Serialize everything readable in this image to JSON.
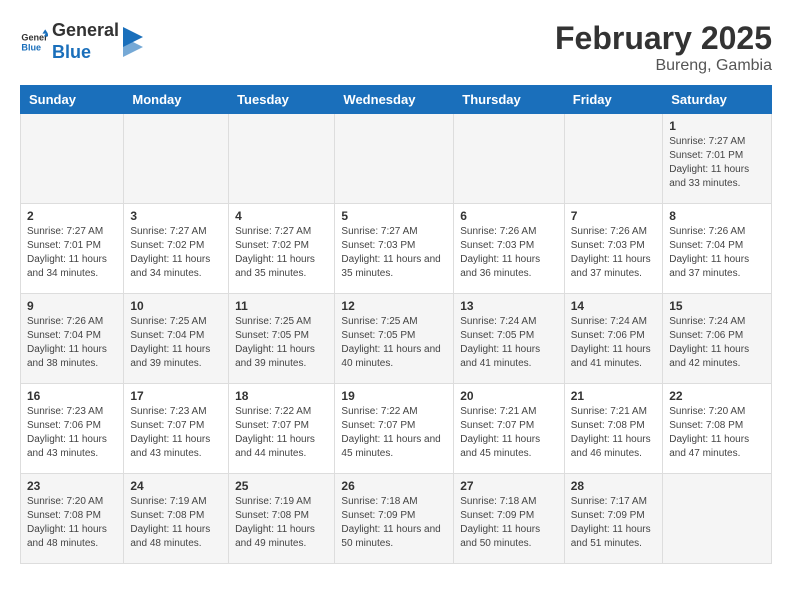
{
  "logo": {
    "text_general": "General",
    "text_blue": "Blue"
  },
  "title": "February 2025",
  "subtitle": "Bureng, Gambia",
  "days_of_week": [
    "Sunday",
    "Monday",
    "Tuesday",
    "Wednesday",
    "Thursday",
    "Friday",
    "Saturday"
  ],
  "weeks": [
    [
      {
        "day": "",
        "info": ""
      },
      {
        "day": "",
        "info": ""
      },
      {
        "day": "",
        "info": ""
      },
      {
        "day": "",
        "info": ""
      },
      {
        "day": "",
        "info": ""
      },
      {
        "day": "",
        "info": ""
      },
      {
        "day": "1",
        "info": "Sunrise: 7:27 AM\nSunset: 7:01 PM\nDaylight: 11 hours and 33 minutes."
      }
    ],
    [
      {
        "day": "2",
        "info": "Sunrise: 7:27 AM\nSunset: 7:01 PM\nDaylight: 11 hours and 34 minutes."
      },
      {
        "day": "3",
        "info": "Sunrise: 7:27 AM\nSunset: 7:02 PM\nDaylight: 11 hours and 34 minutes."
      },
      {
        "day": "4",
        "info": "Sunrise: 7:27 AM\nSunset: 7:02 PM\nDaylight: 11 hours and 35 minutes."
      },
      {
        "day": "5",
        "info": "Sunrise: 7:27 AM\nSunset: 7:03 PM\nDaylight: 11 hours and 35 minutes."
      },
      {
        "day": "6",
        "info": "Sunrise: 7:26 AM\nSunset: 7:03 PM\nDaylight: 11 hours and 36 minutes."
      },
      {
        "day": "7",
        "info": "Sunrise: 7:26 AM\nSunset: 7:03 PM\nDaylight: 11 hours and 37 minutes."
      },
      {
        "day": "8",
        "info": "Sunrise: 7:26 AM\nSunset: 7:04 PM\nDaylight: 11 hours and 37 minutes."
      }
    ],
    [
      {
        "day": "9",
        "info": "Sunrise: 7:26 AM\nSunset: 7:04 PM\nDaylight: 11 hours and 38 minutes."
      },
      {
        "day": "10",
        "info": "Sunrise: 7:25 AM\nSunset: 7:04 PM\nDaylight: 11 hours and 39 minutes."
      },
      {
        "day": "11",
        "info": "Sunrise: 7:25 AM\nSunset: 7:05 PM\nDaylight: 11 hours and 39 minutes."
      },
      {
        "day": "12",
        "info": "Sunrise: 7:25 AM\nSunset: 7:05 PM\nDaylight: 11 hours and 40 minutes."
      },
      {
        "day": "13",
        "info": "Sunrise: 7:24 AM\nSunset: 7:05 PM\nDaylight: 11 hours and 41 minutes."
      },
      {
        "day": "14",
        "info": "Sunrise: 7:24 AM\nSunset: 7:06 PM\nDaylight: 11 hours and 41 minutes."
      },
      {
        "day": "15",
        "info": "Sunrise: 7:24 AM\nSunset: 7:06 PM\nDaylight: 11 hours and 42 minutes."
      }
    ],
    [
      {
        "day": "16",
        "info": "Sunrise: 7:23 AM\nSunset: 7:06 PM\nDaylight: 11 hours and 43 minutes."
      },
      {
        "day": "17",
        "info": "Sunrise: 7:23 AM\nSunset: 7:07 PM\nDaylight: 11 hours and 43 minutes."
      },
      {
        "day": "18",
        "info": "Sunrise: 7:22 AM\nSunset: 7:07 PM\nDaylight: 11 hours and 44 minutes."
      },
      {
        "day": "19",
        "info": "Sunrise: 7:22 AM\nSunset: 7:07 PM\nDaylight: 11 hours and 45 minutes."
      },
      {
        "day": "20",
        "info": "Sunrise: 7:21 AM\nSunset: 7:07 PM\nDaylight: 11 hours and 45 minutes."
      },
      {
        "day": "21",
        "info": "Sunrise: 7:21 AM\nSunset: 7:08 PM\nDaylight: 11 hours and 46 minutes."
      },
      {
        "day": "22",
        "info": "Sunrise: 7:20 AM\nSunset: 7:08 PM\nDaylight: 11 hours and 47 minutes."
      }
    ],
    [
      {
        "day": "23",
        "info": "Sunrise: 7:20 AM\nSunset: 7:08 PM\nDaylight: 11 hours and 48 minutes."
      },
      {
        "day": "24",
        "info": "Sunrise: 7:19 AM\nSunset: 7:08 PM\nDaylight: 11 hours and 48 minutes."
      },
      {
        "day": "25",
        "info": "Sunrise: 7:19 AM\nSunset: 7:08 PM\nDaylight: 11 hours and 49 minutes."
      },
      {
        "day": "26",
        "info": "Sunrise: 7:18 AM\nSunset: 7:09 PM\nDaylight: 11 hours and 50 minutes."
      },
      {
        "day": "27",
        "info": "Sunrise: 7:18 AM\nSunset: 7:09 PM\nDaylight: 11 hours and 50 minutes."
      },
      {
        "day": "28",
        "info": "Sunrise: 7:17 AM\nSunset: 7:09 PM\nDaylight: 11 hours and 51 minutes."
      },
      {
        "day": "",
        "info": ""
      }
    ]
  ]
}
